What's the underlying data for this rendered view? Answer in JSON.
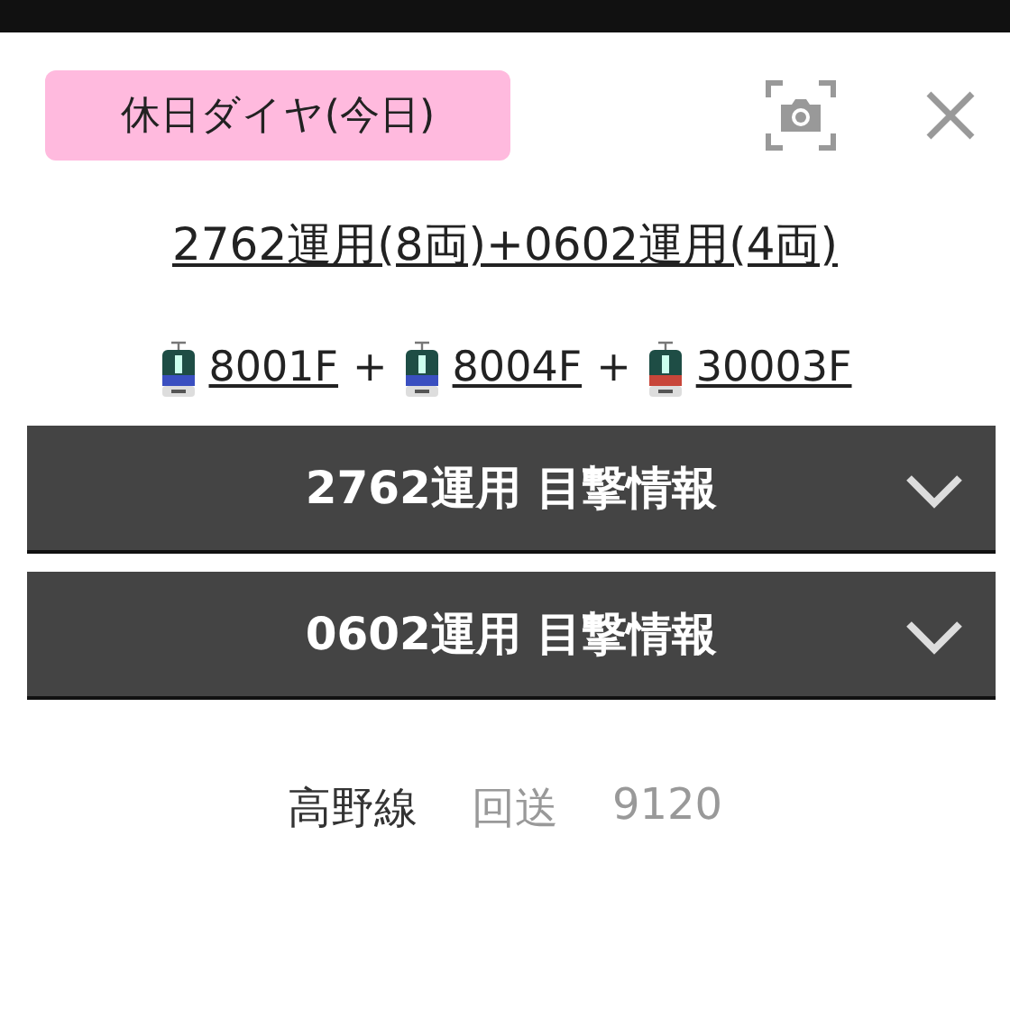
{
  "badge": {
    "label": "休日ダイヤ(今日)"
  },
  "title": "2762運用(8両)+0602運用(4両)",
  "cars": [
    {
      "label": "8001F",
      "color": "#3a4fc0"
    },
    {
      "label": "8004F",
      "color": "#3a4fc0"
    },
    {
      "label": "30003F",
      "color": "#c8463a"
    }
  ],
  "separator": "+",
  "sections": [
    {
      "label": "2762運用 目撃情報",
      "expanded": false
    },
    {
      "label": "0602運用 目撃情報",
      "expanded": false
    }
  ],
  "footer": {
    "line": "高野線",
    "type": "回送",
    "number": "9120"
  }
}
